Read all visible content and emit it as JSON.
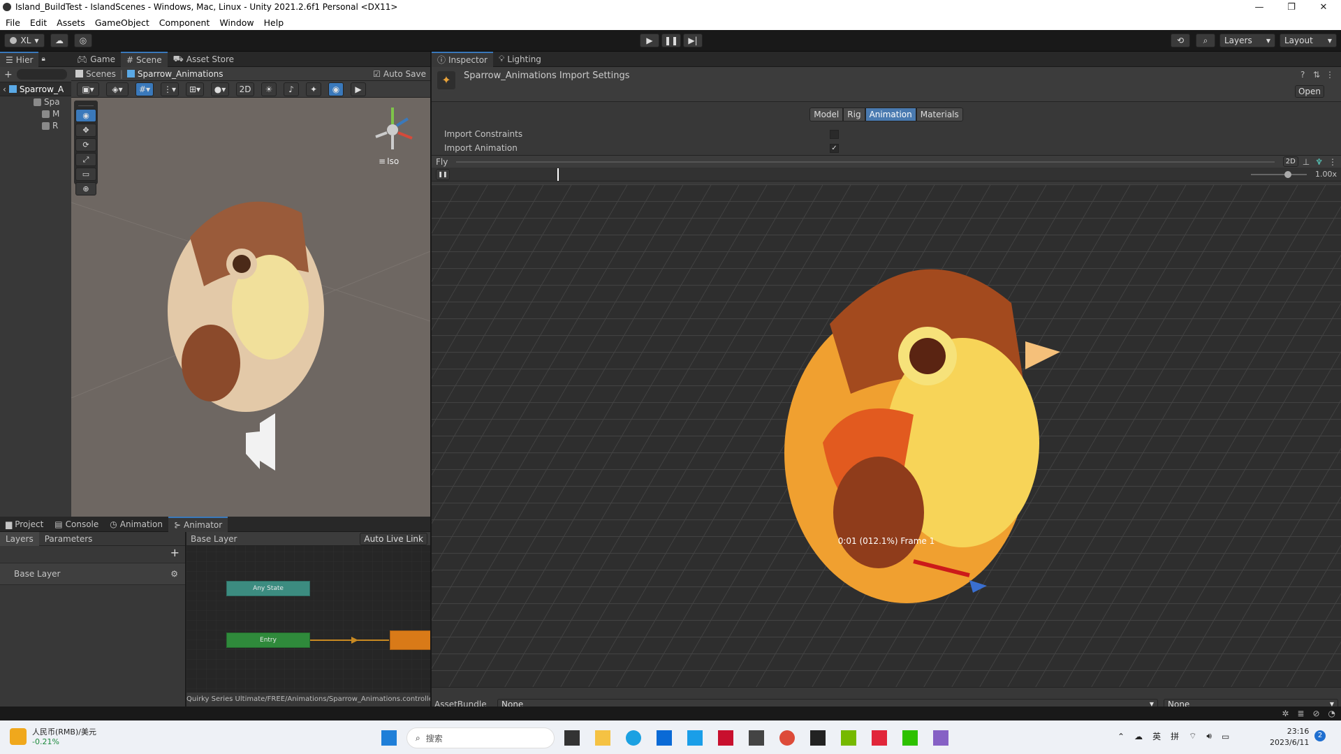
{
  "window": {
    "title": "Island_BuildTest - IslandScenes - Windows, Mac, Linux - Unity 2021.2.6f1 Personal <DX11>",
    "controls": [
      "—",
      "❐",
      "✕"
    ]
  },
  "menu": [
    "File",
    "Edit",
    "Assets",
    "GameObject",
    "Component",
    "Window",
    "Help"
  ],
  "toolbar": {
    "account": "XL",
    "layers": "Layers",
    "layout": "Layout"
  },
  "hierarchy": {
    "tab": "Hier",
    "root": "Sparrow_A",
    "items": [
      "Spa",
      "M",
      "R"
    ]
  },
  "scene_tabs": [
    "Game",
    "Scene",
    "Asset Store"
  ],
  "scene": {
    "breadcrumb_root": "Scenes",
    "breadcrumb_item": "Sparrow_Animations",
    "auto_save": "Auto Save",
    "mode_2d": "2D",
    "iso": "Iso"
  },
  "bottom_tabs": [
    "Project",
    "Console",
    "Animation",
    "Animator"
  ],
  "animator": {
    "left_tabs": [
      "Layers",
      "Parameters"
    ],
    "layer_name": "Base Layer",
    "breadcrumb": "Base Layer",
    "auto_live_link": "Auto Live Link",
    "nodes": [
      "Any State",
      "Entry"
    ],
    "path": "Quirky Series Ultimate/FREE/Animations/Sparrow_Animations.controller"
  },
  "inspector": {
    "tabs": [
      "Inspector",
      "Lighting"
    ],
    "title": "Sparrow_Animations Import Settings",
    "open_button": "Open",
    "sub_tabs": [
      "Model",
      "Rig",
      "Animation",
      "Materials"
    ],
    "active_sub_tab": "Animation",
    "fields": [
      {
        "label": "Import Constraints",
        "checked": false
      },
      {
        "label": "Import Animation",
        "checked": true
      }
    ],
    "preview_clip": "Fly",
    "preview_2d": "2D",
    "speed": "1.00x",
    "frame_info": "0:01 (012.1%) Frame 1",
    "asset_bundle_label": "AssetBundle",
    "asset_bundle_value": "None",
    "asset_bundle_variant": "None"
  },
  "taskbar": {
    "widget_title": "人民币(RMB)/美元",
    "widget_value": "-0.21%",
    "search": "搜索",
    "lang1": "英",
    "lang2": "拼",
    "time": "23:16",
    "date": "2023/6/11",
    "badge": "2"
  }
}
